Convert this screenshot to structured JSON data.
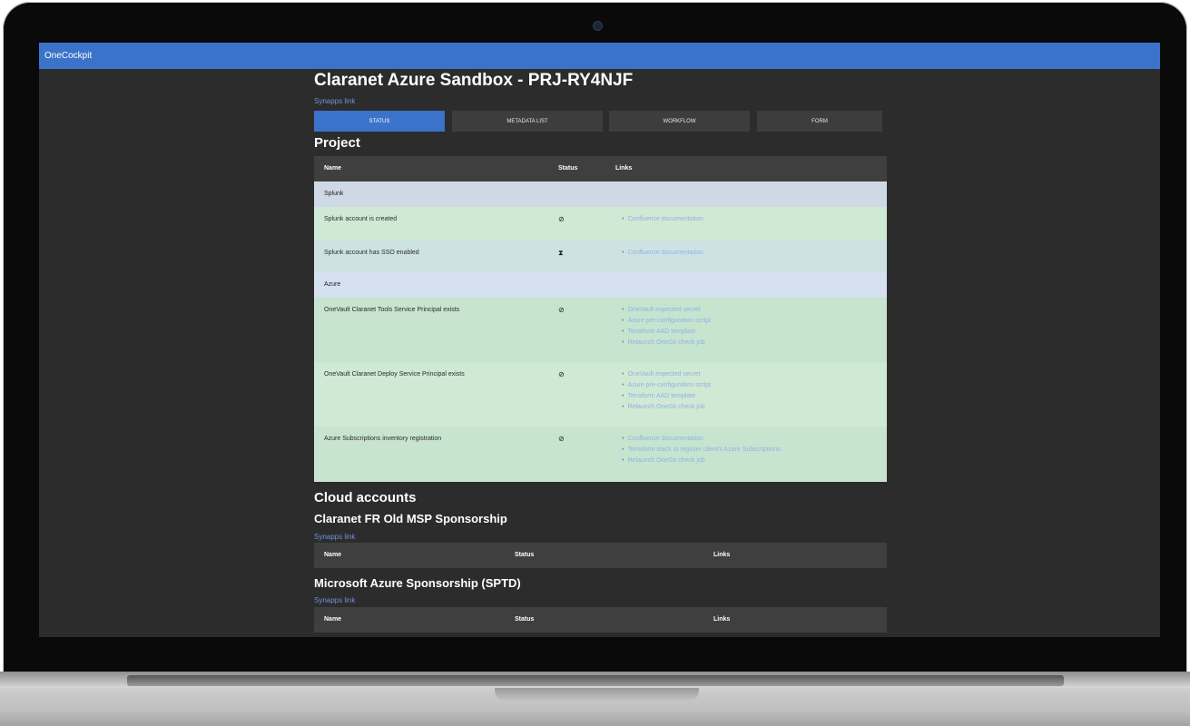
{
  "app": {
    "title": "OneCockpit"
  },
  "page": {
    "title": "Claranet Azure Sandbox - PRJ-RY4NJF",
    "synapps_link": "Synapps link"
  },
  "tabs": [
    {
      "label": "Status",
      "active": true
    },
    {
      "label": "Metadata list",
      "active": false
    },
    {
      "label": "Workflow",
      "active": false
    },
    {
      "label": "Form",
      "active": false
    }
  ],
  "project": {
    "title": "Project",
    "columns": [
      "Name",
      "Status",
      "Links"
    ],
    "groups": [
      {
        "label": "Splunk",
        "rows": [
          {
            "name": "Splunk account is created",
            "status": "✓ (check-circle-icon)",
            "links": [
              "Confluence documentation"
            ]
          },
          {
            "name": "Splunk account has SSO enabled",
            "status": "⧗ (hourglass-icon)",
            "links": [
              "Confluence documentation"
            ]
          }
        ]
      },
      {
        "label": "Azure",
        "rows": [
          {
            "name": "OneVault Claranet Tools Service Principal exists",
            "status": "✓",
            "links": [
              "OneVault expected secret",
              "Azure pre-configuration script",
              "Terraform AAD template",
              "Relaunch OneGit check job"
            ]
          },
          {
            "name": "OneVault Claranet Deploy Service Principal exists",
            "status": "✓",
            "links": [
              "OneVault expected secret",
              "Azure pre-configuration script",
              "Terraform AAD template",
              "Relaunch OneGit check job"
            ]
          },
          {
            "name": "Azure Subscriptions inventory registration",
            "status": "✓",
            "links": [
              "Confluence documentation",
              "Terraform stack to register client's Azure Subscriptions",
              "Relaunch OneGit check job"
            ]
          }
        ]
      }
    ]
  },
  "cloud": {
    "title": "Cloud accounts",
    "columns": [
      "Name",
      "Status",
      "Links"
    ],
    "accounts": [
      {
        "name": "Claranet FR Old MSP Sponsorship",
        "synapps_link": "Synapps link"
      },
      {
        "name": "Microsoft Azure Sponsorship (SPTD)",
        "synapps_link": "Synapps link"
      }
    ]
  }
}
